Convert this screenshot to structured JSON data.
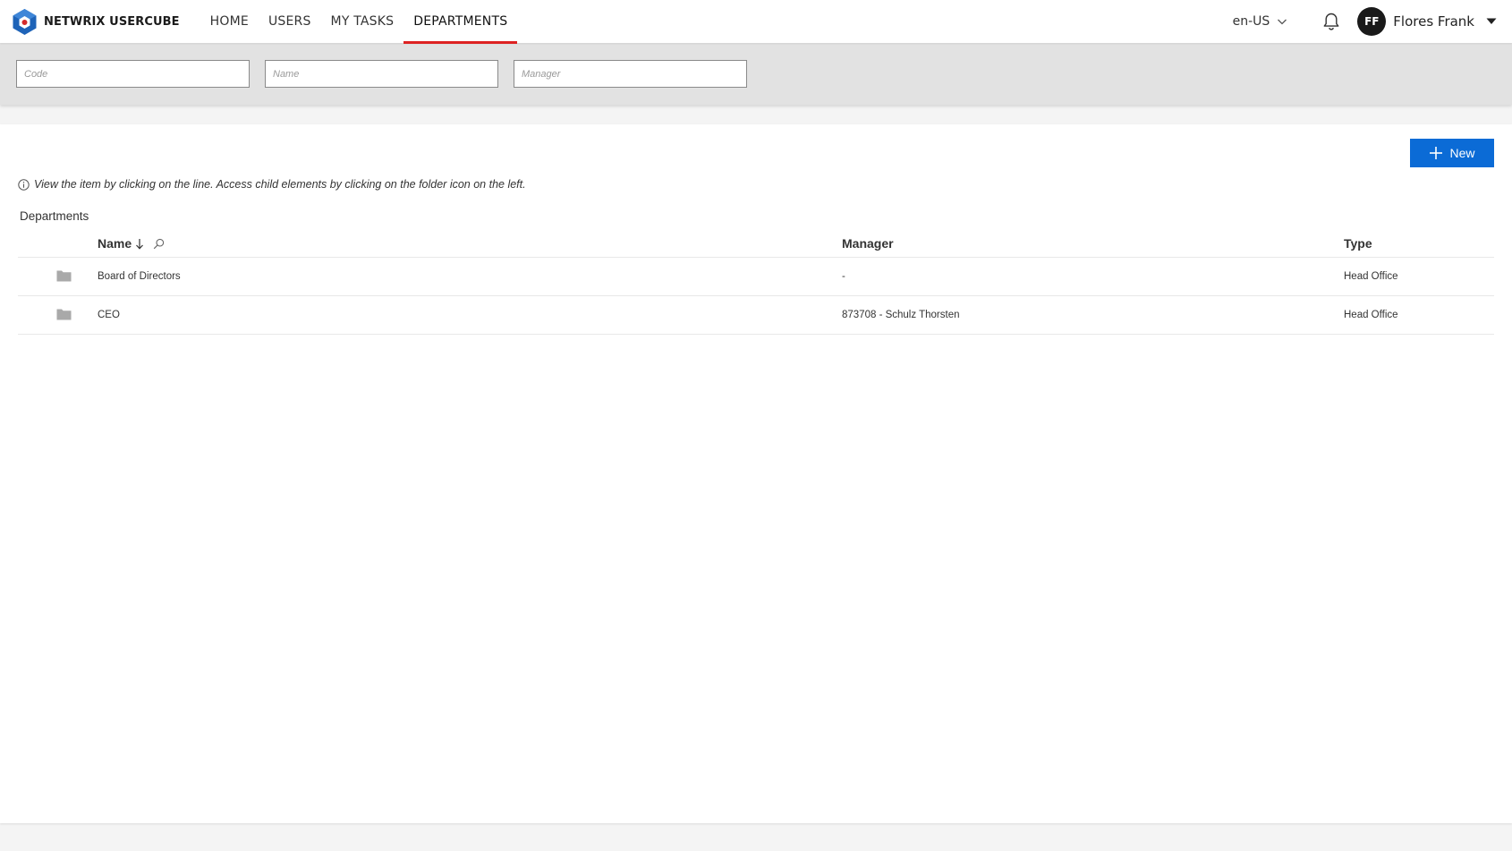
{
  "header": {
    "brand": "NETWRIX USERCUBE",
    "nav": [
      {
        "label": "HOME",
        "active": false
      },
      {
        "label": "USERS",
        "active": false
      },
      {
        "label": "MY TASKS",
        "active": false
      },
      {
        "label": "DEPARTMENTS",
        "active": true
      }
    ],
    "language": "en-US",
    "user": {
      "initials": "FF",
      "name": "Flores Frank"
    }
  },
  "filters": {
    "code_placeholder": "Code",
    "name_placeholder": "Name",
    "manager_placeholder": "Manager"
  },
  "main": {
    "new_label": "New",
    "hint": "View the item by clicking on the line. Access child elements by clicking on the folder icon on the left.",
    "section_title": "Departments",
    "columns": {
      "name": "Name",
      "manager": "Manager",
      "type": "Type"
    },
    "rows": [
      {
        "name": "Board of Directors",
        "manager": "-",
        "type": "Head Office"
      },
      {
        "name": "CEO",
        "manager": "873708 - Schulz Thorsten",
        "type": "Head Office"
      }
    ]
  },
  "colors": {
    "accent": "#0b6bd6",
    "active_tab_underline": "#dd2222",
    "filter_band": "#e2e2e2"
  },
  "icons": [
    "usercube-logo-icon",
    "chevron-down-icon",
    "bell-icon",
    "caret-down-icon",
    "plus-icon",
    "info-icon",
    "sort-down-arrow-icon",
    "search-icon",
    "folder-icon"
  ]
}
